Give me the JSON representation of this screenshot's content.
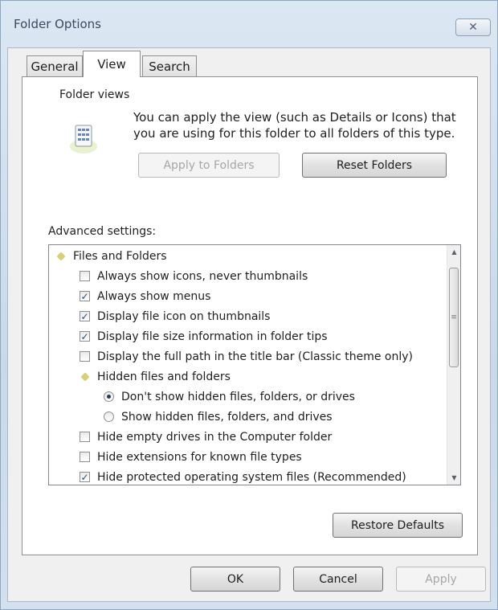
{
  "window": {
    "title": "Folder Options",
    "close_glyph": "✕"
  },
  "tabs": [
    {
      "label": "General"
    },
    {
      "label": "View"
    },
    {
      "label": "Search"
    }
  ],
  "folder_views": {
    "heading": "Folder views",
    "description": "You can apply the view (such as Details or Icons) that you are using for this folder to all folders of this type.",
    "apply_label": "Apply to Folders",
    "reset_label": "Reset Folders"
  },
  "advanced": {
    "heading": "Advanced settings:",
    "items": [
      {
        "label": "Files and Folders",
        "type": "category"
      },
      {
        "label": "Always show icons, never thumbnails",
        "type": "checkbox",
        "checked": false
      },
      {
        "label": "Always show menus",
        "type": "checkbox",
        "checked": true
      },
      {
        "label": "Display file icon on thumbnails",
        "type": "checkbox",
        "checked": true
      },
      {
        "label": "Display file size information in folder tips",
        "type": "checkbox",
        "checked": true
      },
      {
        "label": "Display the full path in the title bar (Classic theme only)",
        "type": "checkbox",
        "checked": false
      },
      {
        "label": "Hidden files and folders",
        "type": "category"
      },
      {
        "label": "Don't show hidden files, folders, or drives",
        "type": "radio",
        "checked": true
      },
      {
        "label": "Show hidden files, folders, and drives",
        "type": "radio",
        "checked": false
      },
      {
        "label": "Hide empty drives in the Computer folder",
        "type": "checkbox",
        "checked": false
      },
      {
        "label": "Hide extensions for known file types",
        "type": "checkbox",
        "checked": false
      },
      {
        "label": "Hide protected operating system files (Recommended)",
        "type": "checkbox",
        "checked": true
      }
    ],
    "check_glyph": "✓",
    "restore_label": "Restore Defaults"
  },
  "footer": {
    "ok_label": "OK",
    "cancel_label": "Cancel",
    "apply_label": "Apply"
  },
  "colors": {
    "panel_bg": "#ffffff",
    "frame": "#c9d9ea",
    "category_icon": "#d9cf79"
  }
}
